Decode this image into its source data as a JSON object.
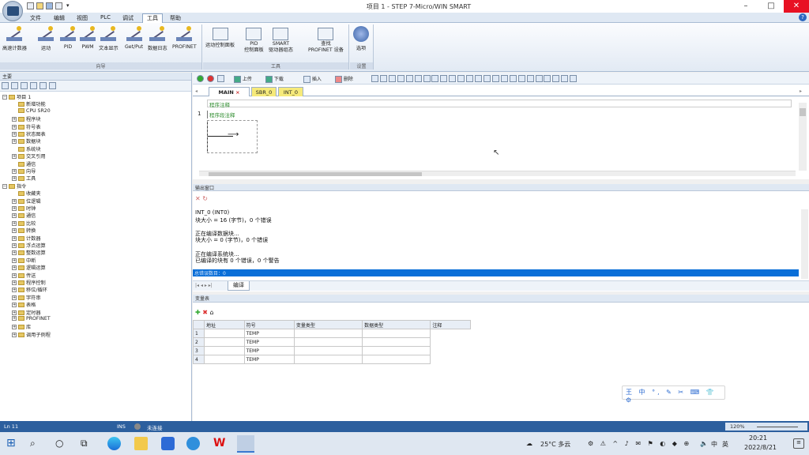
{
  "window": {
    "title": "项目 1 - STEP 7-Micro/WIN SMART",
    "qat_arrow": "▾"
  },
  "menu": [
    "文件",
    "编辑",
    "视图",
    "PLC",
    "调试",
    "工具",
    "帮助"
  ],
  "ribbon": {
    "groups": [
      {
        "label": "向导",
        "items": [
          "高速计数器",
          "运动",
          "PID",
          "PWM",
          "文本显示",
          "Get/Put",
          "数据日志",
          "PROFINET"
        ]
      },
      {
        "label": "工具",
        "items": [
          "运动控制面板",
          "PID\n控制面板",
          "SMART\n驱动器组态",
          "查找\nPROFINET 设备"
        ]
      },
      {
        "label": "设置",
        "items": [
          "选项"
        ]
      }
    ]
  },
  "left_pane": {
    "header": "主要",
    "tree": [
      {
        "label": "项目 1",
        "level": 0,
        "pm": "−"
      },
      {
        "label": "新增功能",
        "level": 1
      },
      {
        "label": "CPU SR20",
        "level": 1
      },
      {
        "label": "程序块",
        "level": 1,
        "pm": "+"
      },
      {
        "label": "符号表",
        "level": 1,
        "pm": "+"
      },
      {
        "label": "状态图表",
        "level": 1,
        "pm": "+"
      },
      {
        "label": "数据块",
        "level": 1,
        "pm": "+"
      },
      {
        "label": "系统块",
        "level": 1
      },
      {
        "label": "交叉引用",
        "level": 1,
        "pm": "+"
      },
      {
        "label": "通信",
        "level": 1
      },
      {
        "label": "向导",
        "level": 1,
        "pm": "+"
      },
      {
        "label": "工具",
        "level": 1,
        "pm": "+"
      },
      {
        "label": "指令",
        "level": 0,
        "pm": "−"
      },
      {
        "label": "收藏夹",
        "level": 1
      },
      {
        "label": "位逻辑",
        "level": 1,
        "pm": "+"
      },
      {
        "label": "时钟",
        "level": 1,
        "pm": "+"
      },
      {
        "label": "通信",
        "level": 1,
        "pm": "+"
      },
      {
        "label": "比较",
        "level": 1,
        "pm": "+"
      },
      {
        "label": "转换",
        "level": 1,
        "pm": "+"
      },
      {
        "label": "计数器",
        "level": 1,
        "pm": "+"
      },
      {
        "label": "浮点运算",
        "level": 1,
        "pm": "+"
      },
      {
        "label": "整数运算",
        "level": 1,
        "pm": "+"
      },
      {
        "label": "中断",
        "level": 1,
        "pm": "+"
      },
      {
        "label": "逻辑运算",
        "level": 1,
        "pm": "+"
      },
      {
        "label": "传送",
        "level": 1,
        "pm": "+"
      },
      {
        "label": "程序控制",
        "level": 1,
        "pm": "+"
      },
      {
        "label": "移位/循环",
        "level": 1,
        "pm": "+"
      },
      {
        "label": "字符串",
        "level": 1,
        "pm": "+"
      },
      {
        "label": "表格",
        "level": 1,
        "pm": "+"
      },
      {
        "label": "定时器",
        "level": 1,
        "pm": "+"
      },
      {
        "label": "PROFINET",
        "level": 1,
        "pm": "+"
      },
      {
        "label": "库",
        "level": 1,
        "pm": "+"
      },
      {
        "label": "调用子例程",
        "level": 1,
        "pm": "+"
      }
    ]
  },
  "editor": {
    "toolbar": [
      "上传",
      "下载",
      "插入",
      "删除"
    ],
    "tabs": [
      "MAIN",
      "SBR_0",
      "INT_0"
    ],
    "tab_close": "×",
    "program_comment": "程序注释",
    "network_number": "1",
    "network_comment": "程序段注释"
  },
  "output": {
    "header": "输出窗口",
    "lines": [
      "INT_0 (INT0)",
      "块大小 = 16 (字节)，0 个错误",
      "",
      "正在编译数据块...",
      "块大小 = 0 (字节)，0 个错误",
      "",
      "正在编译系统块...",
      "已编译的块有 0 个错误，0 个警告"
    ],
    "status": "总错误数目：0",
    "tab": "编译"
  },
  "vars": {
    "header": "变量表",
    "columns": [
      "地址",
      "符号",
      "变量类型",
      "数据类型",
      "注释"
    ],
    "rows": [
      [
        "1",
        "",
        "TEMP",
        "",
        ""
      ],
      [
        "2",
        "",
        "TEMP",
        "",
        ""
      ],
      [
        "3",
        "",
        "TEMP",
        "",
        ""
      ],
      [
        "4",
        "",
        "TEMP",
        "",
        ""
      ]
    ]
  },
  "ime": {
    "label": "王 中 °, ✎ ✂ ⌨ 👕 ⚙"
  },
  "statusbar": {
    "position": "Ln 11",
    "mode": "INS",
    "connection": "未连接",
    "zoom": "120%"
  },
  "taskbar": {
    "weather": "25°C 多云",
    "time": "20:21",
    "date": "2022/8/21",
    "ime": "中",
    "input": "英"
  }
}
